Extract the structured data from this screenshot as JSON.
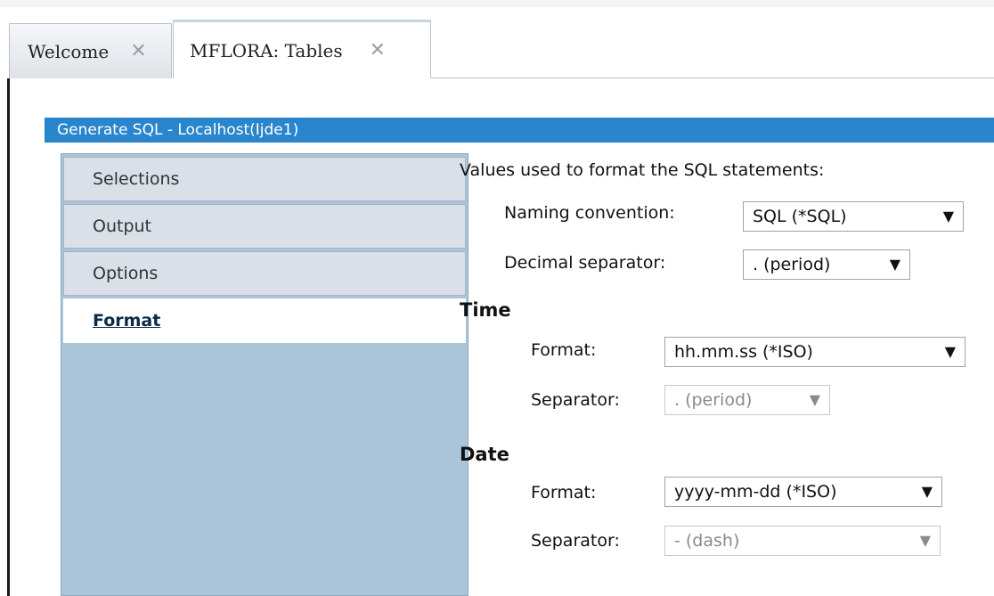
{
  "tabs": [
    {
      "label": "Welcome",
      "close_glyph": "✕"
    },
    {
      "label": "MFLORA: Tables",
      "close_glyph": "✕"
    }
  ],
  "dialog": {
    "title": "Generate SQL - Localhost(Ijde1)",
    "nav": [
      "Selections",
      "Output",
      "Options",
      "Format"
    ],
    "active_nav": "Format",
    "intro": "Values used to format the SQL statements:",
    "naming": {
      "label": "Naming convention:",
      "value": "SQL (*SQL)"
    },
    "decimal": {
      "label": "Decimal separator:",
      "value": ". (period)"
    },
    "time": {
      "heading": "Time",
      "format_label": "Format:",
      "format_value": "hh.mm.ss (*ISO)",
      "separator_label": "Separator:",
      "separator_value": ". (period)"
    },
    "date": {
      "heading": "Date",
      "format_label": "Format:",
      "format_value": "yyyy-mm-dd (*ISO)",
      "separator_label": "Separator:",
      "separator_value": "- (dash)"
    }
  },
  "icons": {
    "dropdown_arrow": "▼"
  },
  "colors": {
    "titlebar": "#2a86cc",
    "nav_panel": "#aac4d9",
    "nav_item": "#d9e0e8"
  }
}
